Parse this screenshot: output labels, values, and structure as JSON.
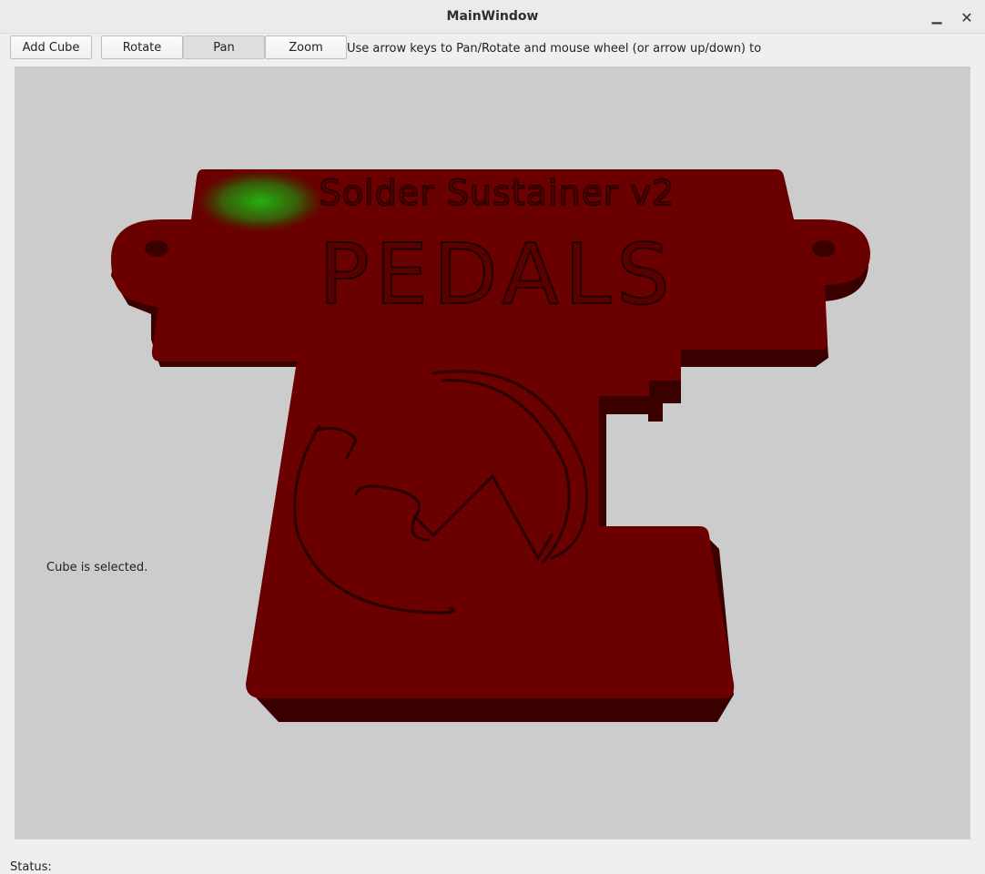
{
  "window": {
    "title": "MainWindow",
    "minimize_icon": "minimize-icon",
    "close_icon": "close-icon"
  },
  "toolbar": {
    "add_cube_label": "Add Cube",
    "rotate_label": "Rotate",
    "pan_label": "Pan",
    "zoom_label": "Zoom",
    "active_mode": "Pan",
    "hint_text": "Use arrow keys to Pan/Rotate and mouse wheel (or arrow up/down) to"
  },
  "viewport": {
    "background_color": "#cccccc",
    "model_color": "#6b0000",
    "highlight_color": "#22aa11",
    "selection_text": "Cube is selected.",
    "model_text_top": "Solder Sustainer v2",
    "model_text_main": "PEDALS"
  },
  "status": {
    "label": "Status:"
  }
}
